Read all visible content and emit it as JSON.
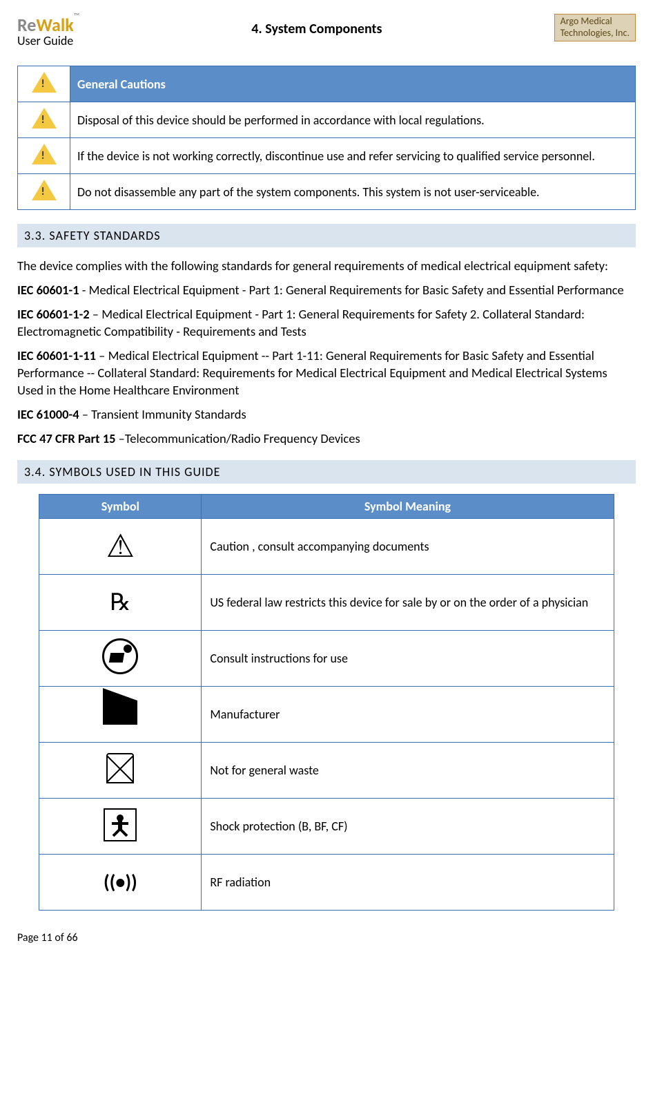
{
  "header": {
    "logo_re": "Re",
    "logo_walk": "Walk",
    "logo_tm": "™",
    "user_guide": "User Guide",
    "chapter": "4. System Components",
    "company_line1": "Argo Medical",
    "company_line2": "Technologies, Inc."
  },
  "cautions": {
    "title": "General Cautions",
    "items": [
      "Disposal of this device should be performed in accordance with local regulations.",
      "If the device is not working correctly, discontinue use and refer servicing to qualified service personnel.",
      "Do not disassemble any part of the system components. This system is not user-serviceable."
    ]
  },
  "section33": {
    "heading": "3.3. SAFETY STANDARDS",
    "intro": "The device complies with the following standards for general requirements of medical electrical equipment safety:",
    "std1_code": "IEC 60601-1",
    "std1_text": " - Medical Electrical Equipment - Part 1: General Requirements for Basic Safety and Essential Performance",
    "std2_code": "IEC 60601-1-2",
    "std2_text": " – Medical Electrical Equipment - Part 1: General Requirements for Safety 2. Collateral Standard: Electromagnetic Compatibility - Requirements and Tests",
    "std3_code": "IEC 60601-1-11",
    "std3_text": " – Medical Electrical Equipment -- Part 1-11: General Requirements for Basic Safety and Essential Performance -- Collateral Standard: Requirements for Medical Electrical Equipment and Medical Electrical Systems Used in the Home Healthcare Environment",
    "std4_code": "IEC 61000-4",
    "std4_text": " – Transient Immunity Standards",
    "std5_code": "FCC 47 CFR Part 15",
    "std5_text": " –Telecommunication/Radio Frequency Devices"
  },
  "section34": {
    "heading": "3.4. SYMBOLS USED IN THIS GUIDE",
    "col_symbol": "Symbol",
    "col_meaning": "Symbol Meaning",
    "rows": [
      "Caution , consult accompanying documents",
      "US federal law restricts this device for sale by or on the order of a physician",
      "Consult instructions for use",
      "Manufacturer",
      "Not for general waste",
      "Shock protection (B, BF, CF)",
      "RF radiation"
    ]
  },
  "footer": {
    "page": "Page 11 of 66"
  }
}
